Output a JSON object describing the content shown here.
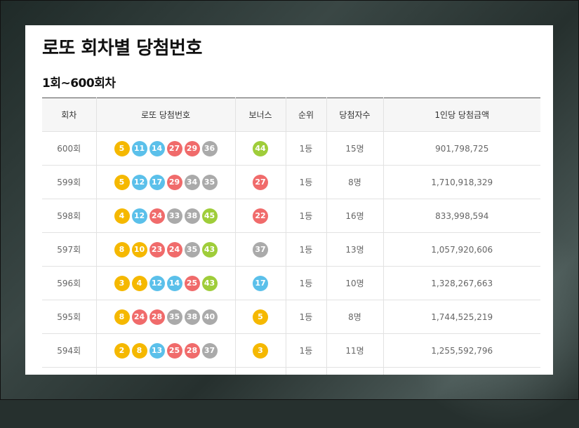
{
  "page": {
    "title": "로또 회차별 당첨번호",
    "section_title": "1회~600회차"
  },
  "table": {
    "headers": {
      "round": "회차",
      "numbers": "로또 당첨번호",
      "bonus": "보너스",
      "rank": "순위",
      "winners": "당첨자수",
      "prize": "1인당 당첨금액"
    },
    "rows": [
      {
        "round": "600회",
        "numbers": [
          "5",
          "11",
          "14",
          "27",
          "29",
          "36"
        ],
        "bonus": "44",
        "rank": "1등",
        "winners": "15명",
        "prize": "901,798,725"
      },
      {
        "round": "599회",
        "numbers": [
          "5",
          "12",
          "17",
          "29",
          "34",
          "35"
        ],
        "bonus": "27",
        "rank": "1등",
        "winners": "8명",
        "prize": "1,710,918,329"
      },
      {
        "round": "598회",
        "numbers": [
          "4",
          "12",
          "24",
          "33",
          "38",
          "45"
        ],
        "bonus": "22",
        "rank": "1등",
        "winners": "16명",
        "prize": "833,998,594"
      },
      {
        "round": "597회",
        "numbers": [
          "8",
          "10",
          "23",
          "24",
          "35",
          "43"
        ],
        "bonus": "37",
        "rank": "1등",
        "winners": "13명",
        "prize": "1,057,920,606"
      },
      {
        "round": "596회",
        "numbers": [
          "3",
          "4",
          "12",
          "14",
          "25",
          "43"
        ],
        "bonus": "17",
        "rank": "1등",
        "winners": "10명",
        "prize": "1,328,267,663"
      },
      {
        "round": "595회",
        "numbers": [
          "8",
          "24",
          "28",
          "35",
          "38",
          "40"
        ],
        "bonus": "5",
        "rank": "1등",
        "winners": "8명",
        "prize": "1,744,525,219"
      },
      {
        "round": "594회",
        "numbers": [
          "2",
          "8",
          "13",
          "25",
          "28",
          "37"
        ],
        "bonus": "3",
        "rank": "1등",
        "winners": "11명",
        "prize": "1,255,592,796"
      }
    ]
  },
  "ball_colors": {
    "1-10": "#f5b800",
    "11-20": "#5bc0ea",
    "21-30": "#f06b6b",
    "31-40": "#aaaaaa",
    "41-45": "#9fcd3a"
  },
  "prize_color": "#c0392b"
}
